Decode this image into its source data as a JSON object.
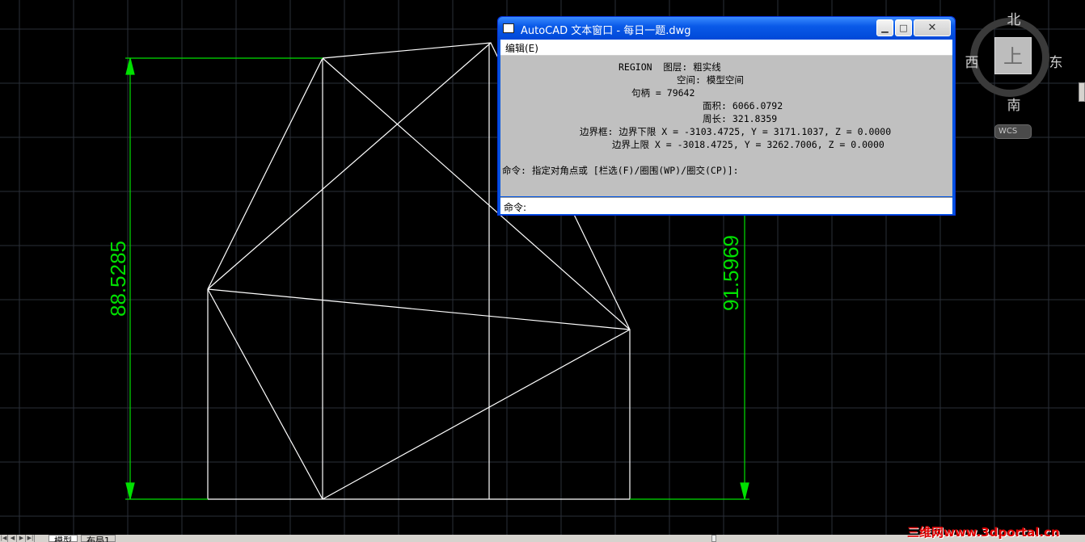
{
  "drawing": {
    "dimension_left": "88.5285",
    "dimension_right": "91.5969",
    "colors": {
      "geometry": "#ffffff",
      "dimension": "#00e000",
      "grid": "#2a2f38"
    }
  },
  "viewcube": {
    "north": "北",
    "south": "南",
    "west": "西",
    "east": "东",
    "face": "上",
    "wcs_label": "WCS"
  },
  "text_window": {
    "title": "AutoCAD 文本窗口 - 每日一题.dwg",
    "menu_edit": "编辑(E)",
    "history": [
      "REGION  图层: 粗实线",
      "空间: 模型空间",
      "句柄 = 79642",
      "面积: 6066.0792",
      "周长: 321.8359",
      "边界框: 边界下限 X = -3103.4725, Y = 3171.1037, Z = 0.0000",
      "边界上限 X = -3018.4725, Y = 3262.7006, Z = 0.0000",
      "命令: 指定对角点或 [栏选(F)/圈围(WP)/圈交(CP)]:"
    ],
    "command_prompt": "命令:"
  },
  "tabs": {
    "model": "模型",
    "layout1": "布局1"
  },
  "watermark": "三维网www.3dportal.cn"
}
